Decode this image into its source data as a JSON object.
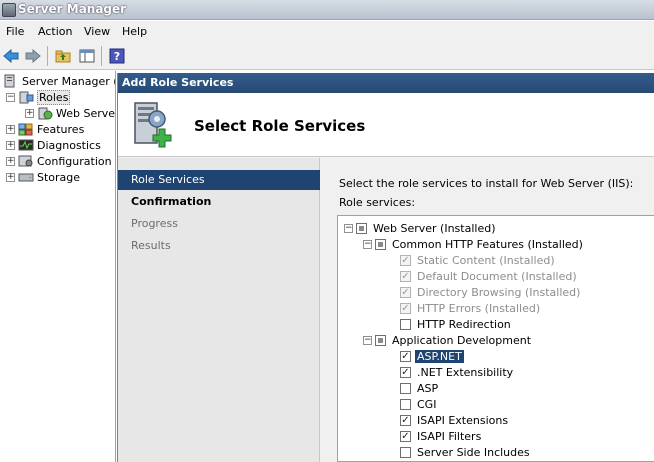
{
  "window": {
    "title": "Server Manager"
  },
  "menu": [
    "File",
    "Action",
    "View",
    "Help"
  ],
  "tree": {
    "root": "Server Manager (W",
    "roles": "Roles",
    "web_server": "Web Server",
    "features": "Features",
    "diagnostics": "Diagnostics",
    "configuration": "Configuration",
    "storage": "Storage"
  },
  "dialog": {
    "title": "Add Role Services",
    "heading": "Select Role Services",
    "nav": [
      "Role Services",
      "Confirmation",
      "Progress",
      "Results"
    ],
    "instruction": "Select the role services to install for Web Server (IIS):",
    "list_label": "Role services:",
    "services": [
      {
        "label": "Web Server  (Installed)",
        "state": "partial"
      },
      {
        "label": "Common HTTP Features  (Installed)",
        "state": "partial"
      },
      {
        "label": "Static Content  (Installed)",
        "state": "checked-disabled"
      },
      {
        "label": "Default Document  (Installed)",
        "state": "checked-disabled"
      },
      {
        "label": "Directory Browsing  (Installed)",
        "state": "checked-disabled"
      },
      {
        "label": "HTTP Errors  (Installed)",
        "state": "checked-disabled"
      },
      {
        "label": "HTTP Redirection",
        "state": "unchecked"
      },
      {
        "label": "Application Development",
        "state": "partial"
      },
      {
        "label": "ASP.NET",
        "state": "checked"
      },
      {
        "label": ".NET Extensibility",
        "state": "checked"
      },
      {
        "label": "ASP",
        "state": "unchecked"
      },
      {
        "label": "CGI",
        "state": "unchecked"
      },
      {
        "label": "ISAPI Extensions",
        "state": "checked"
      },
      {
        "label": "ISAPI Filters",
        "state": "checked"
      },
      {
        "label": "Server Side Includes",
        "state": "unchecked"
      }
    ]
  },
  "colors": {
    "accent": "#1f4471",
    "dialog_title": "#2d5584"
  }
}
